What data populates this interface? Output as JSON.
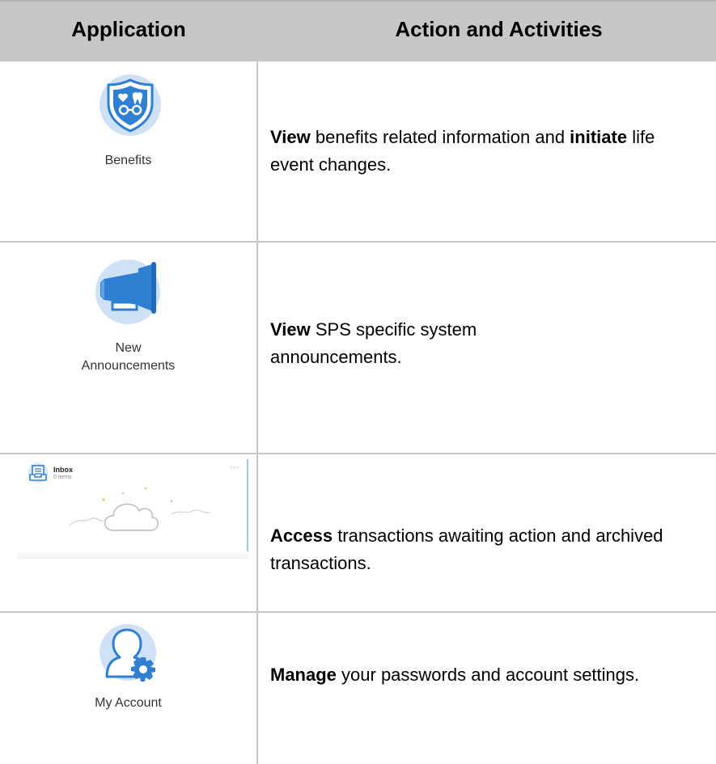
{
  "header": {
    "col_application": "Application",
    "col_actions": "Action and Activities"
  },
  "rows": [
    {
      "app_label": "Benefits",
      "icon": "shield-icon",
      "desc_bold1": "View",
      "desc_text1": " benefits related information and ",
      "desc_bold2": "initiate",
      "desc_text2": " life event changes."
    },
    {
      "app_label_line1": "New",
      "app_label_line2": "Announcements",
      "icon": "megaphone-icon",
      "desc_bold1": "View",
      "desc_text1": " SPS specific system announcements."
    },
    {
      "icon": "inbox-icon",
      "inbox_title": "Inbox",
      "inbox_sub": "0 items",
      "inbox_menu": "···",
      "desc_bold1": "Access",
      "desc_text1": " transactions awaiting action and archived transactions."
    },
    {
      "app_label": "My Account",
      "icon": "user-gear-icon",
      "desc_bold1": "Manage",
      "desc_text1": " your passwords and account settings."
    }
  ],
  "colors": {
    "header_bg": "#c7c7c7",
    "grid_line": "#c6c6c6",
    "icon_circle": "#cfe2f5",
    "icon_blue": "#2f7fd3"
  }
}
